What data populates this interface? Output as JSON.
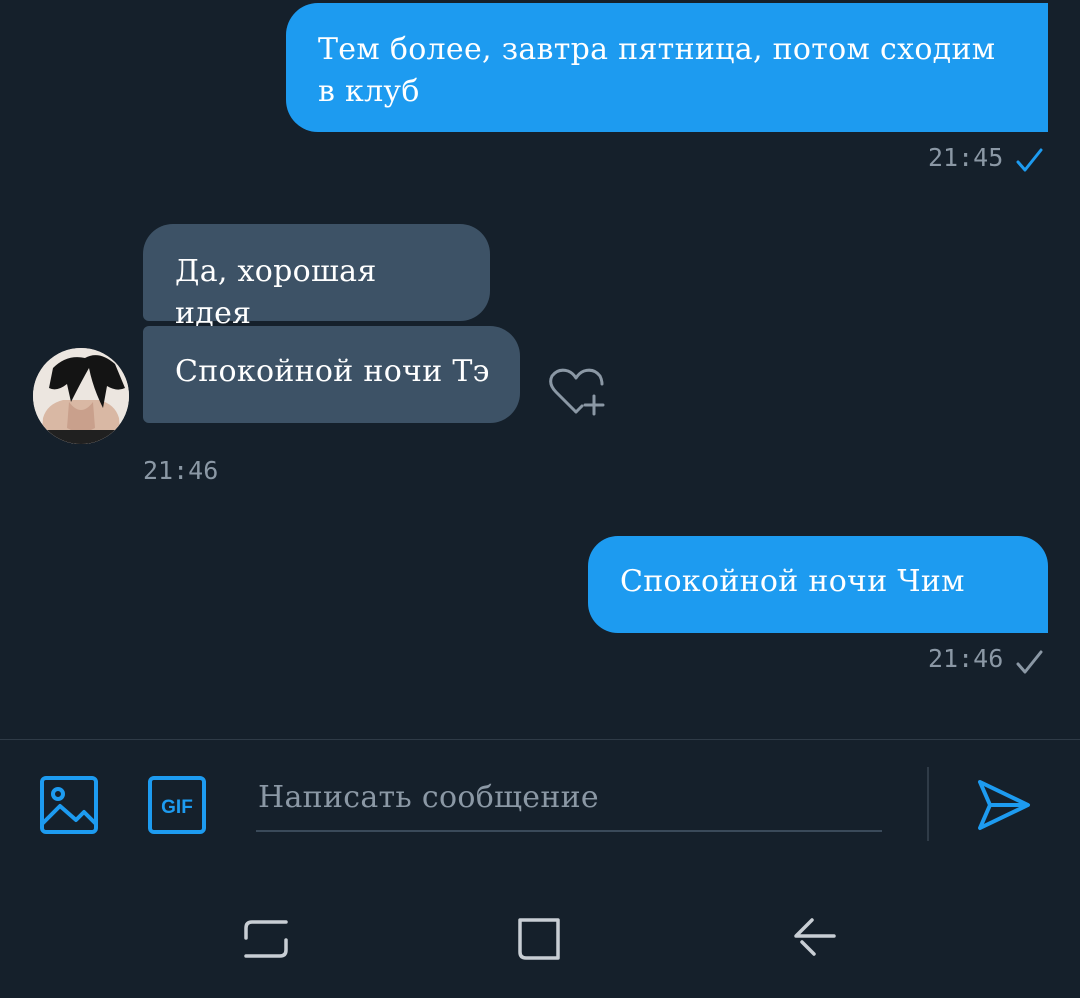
{
  "messages": {
    "out_1": {
      "text": "Тем более, завтра пятница, потом сходим в клуб",
      "time": "21:45"
    },
    "in_1": {
      "text": "Да, хорошая идея"
    },
    "in_2": {
      "text": "Спокойной ночи Тэ"
    },
    "in_time": "21:46",
    "out_2": {
      "text": "Спокойной ночи Чим",
      "time": "21:46"
    }
  },
  "composer": {
    "placeholder": "Написать сообщение",
    "gif_label": "GIF"
  },
  "colors": {
    "background": "#15202b",
    "outgoing_bubble": "#1d9bf0",
    "incoming_bubble": "#3d5266",
    "accent": "#1d9bf0",
    "muted_text": "#8b98a5"
  },
  "icons": {
    "read_check": "check-icon",
    "delivered_check": "check-icon",
    "react": "heart-plus-icon",
    "image": "image-icon",
    "gif": "gif-icon",
    "send": "send-icon",
    "nav_recents": "recents-icon",
    "nav_home": "home-icon",
    "nav_back": "back-icon"
  }
}
